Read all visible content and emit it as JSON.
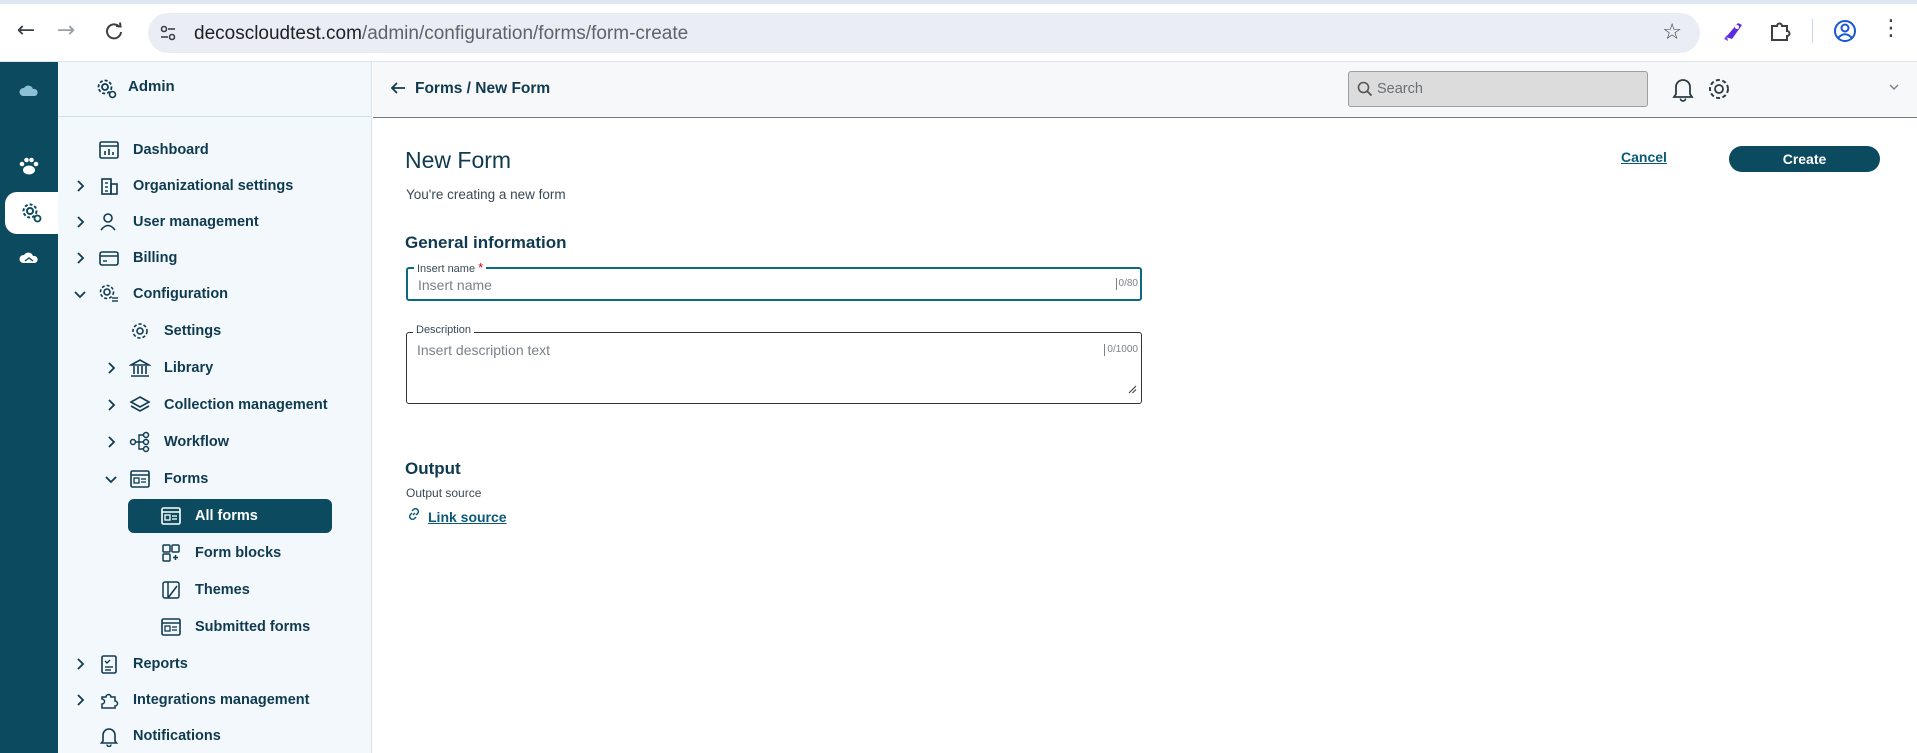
{
  "browser": {
    "url_host": "decoscloudtest.com",
    "url_path": "/admin/configuration/forms/form-create",
    "icons": [
      "back-icon",
      "forward-icon",
      "reload-icon",
      "site-info-icon",
      "bookmark-star-icon",
      "rocket-extension-icon",
      "puzzle-extension-icon",
      "profile-icon",
      "menu-dots-icon"
    ]
  },
  "colors": {
    "accent": "#0b4a5f",
    "link": "#0b5a77",
    "required": "#d0021b",
    "sidebar_bg": "#f2f8fc"
  },
  "rail": {
    "items": [
      "cloud-logo-icon",
      "paw-icon",
      "admin-gear-icon",
      "cloud-alt-icon"
    ],
    "active_index": 2
  },
  "sidebar": {
    "header": "Admin",
    "items": [
      {
        "label": "Dashboard",
        "icon": "dashboard-icon",
        "expandable": false
      },
      {
        "label": "Organizational settings",
        "icon": "building-icon",
        "expandable": true
      },
      {
        "label": "User management",
        "icon": "user-icon",
        "expandable": true
      },
      {
        "label": "Billing",
        "icon": "card-icon",
        "expandable": true
      },
      {
        "label": "Configuration",
        "icon": "config-gear-icon",
        "expandable": true,
        "expanded": true
      },
      {
        "label": "Settings",
        "icon": "settings-icon",
        "expandable": false
      },
      {
        "label": "Library",
        "icon": "library-icon",
        "expandable": true
      },
      {
        "label": "Collection management",
        "icon": "layers-icon",
        "expandable": true
      },
      {
        "label": "Workflow",
        "icon": "workflow-icon",
        "expandable": true
      },
      {
        "label": "Forms",
        "icon": "form-icon",
        "expandable": true,
        "expanded": true
      },
      {
        "label": "All forms",
        "icon": "form-list-icon",
        "active": true
      },
      {
        "label": "Form blocks",
        "icon": "blocks-icon"
      },
      {
        "label": "Themes",
        "icon": "themes-icon"
      },
      {
        "label": "Submitted forms",
        "icon": "submitted-icon"
      },
      {
        "label": "Reports",
        "icon": "report-icon",
        "expandable": true
      },
      {
        "label": "Integrations management",
        "icon": "puzzle-icon",
        "expandable": true
      },
      {
        "label": "Notifications",
        "icon": "bell-icon",
        "expandable": false
      }
    ]
  },
  "topbar": {
    "breadcrumb": "Forms / New Form",
    "search_placeholder": "Search"
  },
  "page": {
    "title": "New Form",
    "subtitle": "You're creating a new form",
    "cancel_label": "Cancel",
    "create_label": "Create",
    "general_heading": "General information",
    "name_label": "Insert name",
    "name_required_mark": "*",
    "name_placeholder": "Insert name",
    "name_value": "",
    "name_counter": "0/80",
    "desc_label": "Description",
    "desc_placeholder": "Insert description text",
    "desc_value": "",
    "desc_counter": "0/1000",
    "output_heading": "Output",
    "output_source_label": "Output source",
    "link_source_label": "Link source"
  }
}
